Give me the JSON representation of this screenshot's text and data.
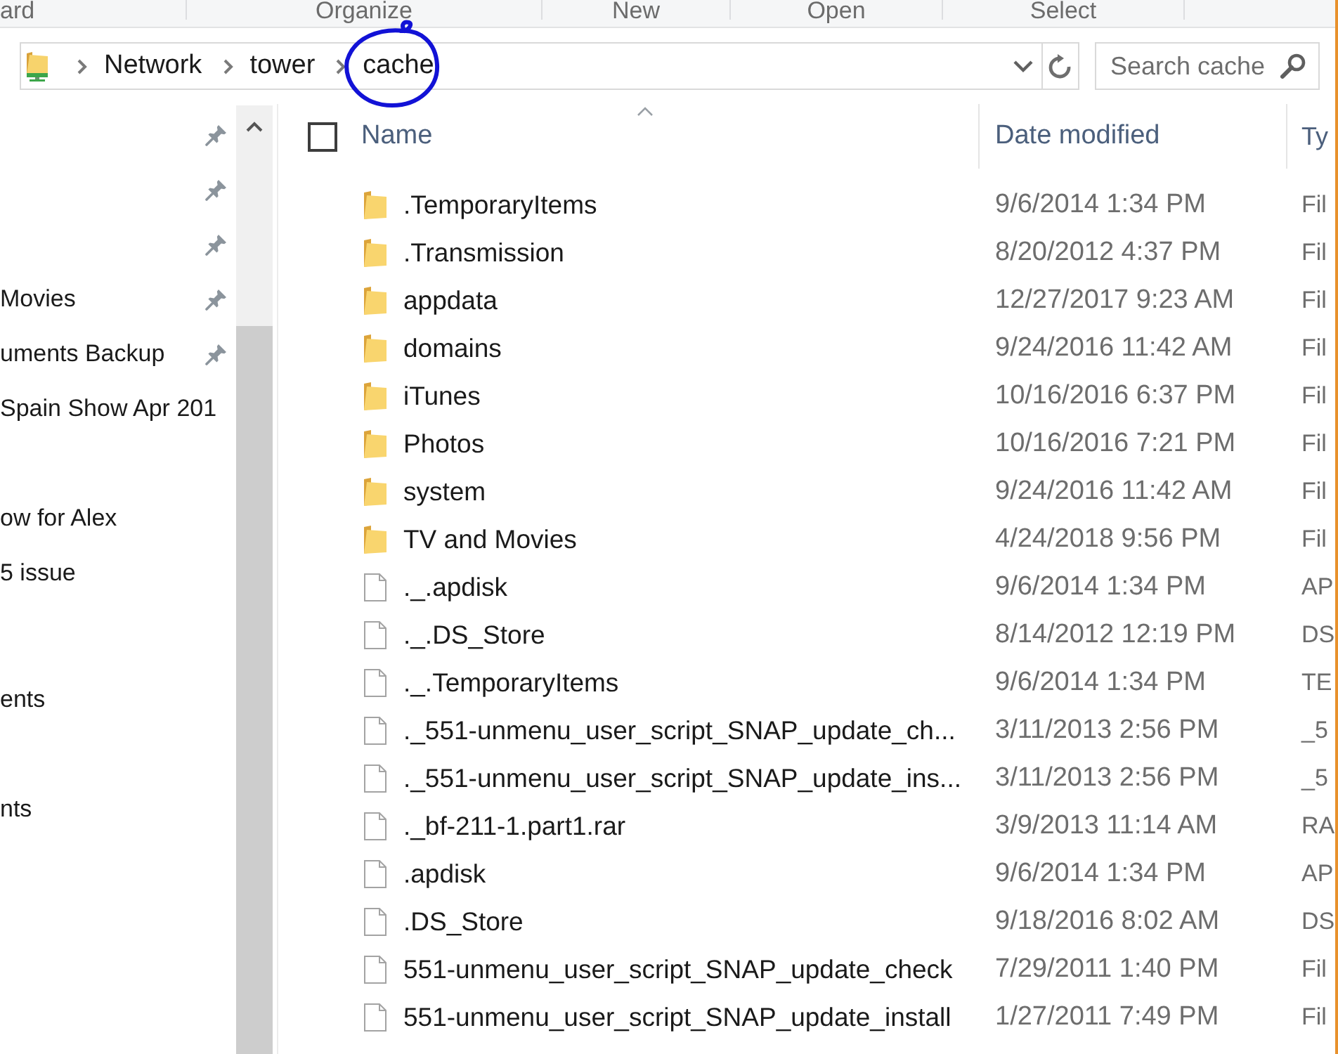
{
  "ribbon": {
    "groups": [
      "ard",
      "Organize",
      "New",
      "Open",
      "Select"
    ]
  },
  "address": {
    "breadcrumbs": [
      {
        "label": "Network",
        "circled": false
      },
      {
        "label": "tower",
        "circled": false
      },
      {
        "label": "cache",
        "circled": true
      }
    ]
  },
  "search": {
    "placeholder": "Search cache"
  },
  "navigation": {
    "items": [
      {
        "pinned": true
      },
      {
        "pinned": true
      },
      {
        "pinned": true
      },
      {
        "label": "Movies",
        "pinned": true
      },
      {
        "label": "uments Backup",
        "pinned": true
      },
      {
        "label": "Spain Show Apr 201",
        "pinned": false
      },
      {
        "label": "ow for Alex",
        "pinned": false
      },
      {
        "label": "5 issue",
        "pinned": false
      },
      {
        "label": "ents",
        "pinned": false
      },
      {
        "label": "nts",
        "pinned": false
      }
    ]
  },
  "file_list": {
    "select_all": {
      "checked": false
    },
    "columns": [
      {
        "label": "Name",
        "sorted": true
      },
      {
        "label": "Date modified",
        "sorted": false
      },
      {
        "label": "Ty",
        "sorted": false
      }
    ],
    "rows": [
      {
        "kind": "folder",
        "name": ".TemporaryItems",
        "date": "9/6/2014 1:34 PM",
        "type": "Fil"
      },
      {
        "kind": "folder",
        "name": ".Transmission",
        "date": "8/20/2012 4:37 PM",
        "type": "Fil"
      },
      {
        "kind": "folder",
        "name": "appdata",
        "date": "12/27/2017 9:23 AM",
        "type": "Fil"
      },
      {
        "kind": "folder",
        "name": "domains",
        "date": "9/24/2016 11:42 AM",
        "type": "Fil"
      },
      {
        "kind": "folder",
        "name": "iTunes",
        "date": "10/16/2016 6:37 PM",
        "type": "Fil"
      },
      {
        "kind": "folder",
        "name": "Photos",
        "date": "10/16/2016 7:21 PM",
        "type": "Fil"
      },
      {
        "kind": "folder",
        "name": "system",
        "date": "9/24/2016 11:42 AM",
        "type": "Fil"
      },
      {
        "kind": "folder",
        "name": "TV and Movies",
        "date": "4/24/2018 9:56 PM",
        "type": "Fil"
      },
      {
        "kind": "file",
        "name": "._.apdisk",
        "date": "9/6/2014 1:34 PM",
        "type": "AP"
      },
      {
        "kind": "file",
        "name": "._.DS_Store",
        "date": "8/14/2012 12:19 PM",
        "type": "DS"
      },
      {
        "kind": "file",
        "name": "._.TemporaryItems",
        "date": "9/6/2014 1:34 PM",
        "type": "TE"
      },
      {
        "kind": "file",
        "name": "._551-unmenu_user_script_SNAP_update_ch...",
        "date": "3/11/2013 2:56 PM",
        "type": "_5"
      },
      {
        "kind": "file",
        "name": "._551-unmenu_user_script_SNAP_update_ins...",
        "date": "3/11/2013 2:56 PM",
        "type": "_5"
      },
      {
        "kind": "file",
        "name": "._bf-211-1.part1.rar",
        "date": "3/9/2013 11:14 AM",
        "type": "RA"
      },
      {
        "kind": "file",
        "name": ".apdisk",
        "date": "9/6/2014 1:34 PM",
        "type": "AP"
      },
      {
        "kind": "file",
        "name": ".DS_Store",
        "date": "9/18/2016 8:02 AM",
        "type": "DS"
      },
      {
        "kind": "file",
        "name": "551-unmenu_user_script_SNAP_update_check",
        "date": "7/29/2011 1:40 PM",
        "type": "Fil"
      },
      {
        "kind": "file",
        "name": "551-unmenu_user_script_SNAP_update_install",
        "date": "1/27/2011 7:49 PM",
        "type": "Fil"
      }
    ]
  }
}
